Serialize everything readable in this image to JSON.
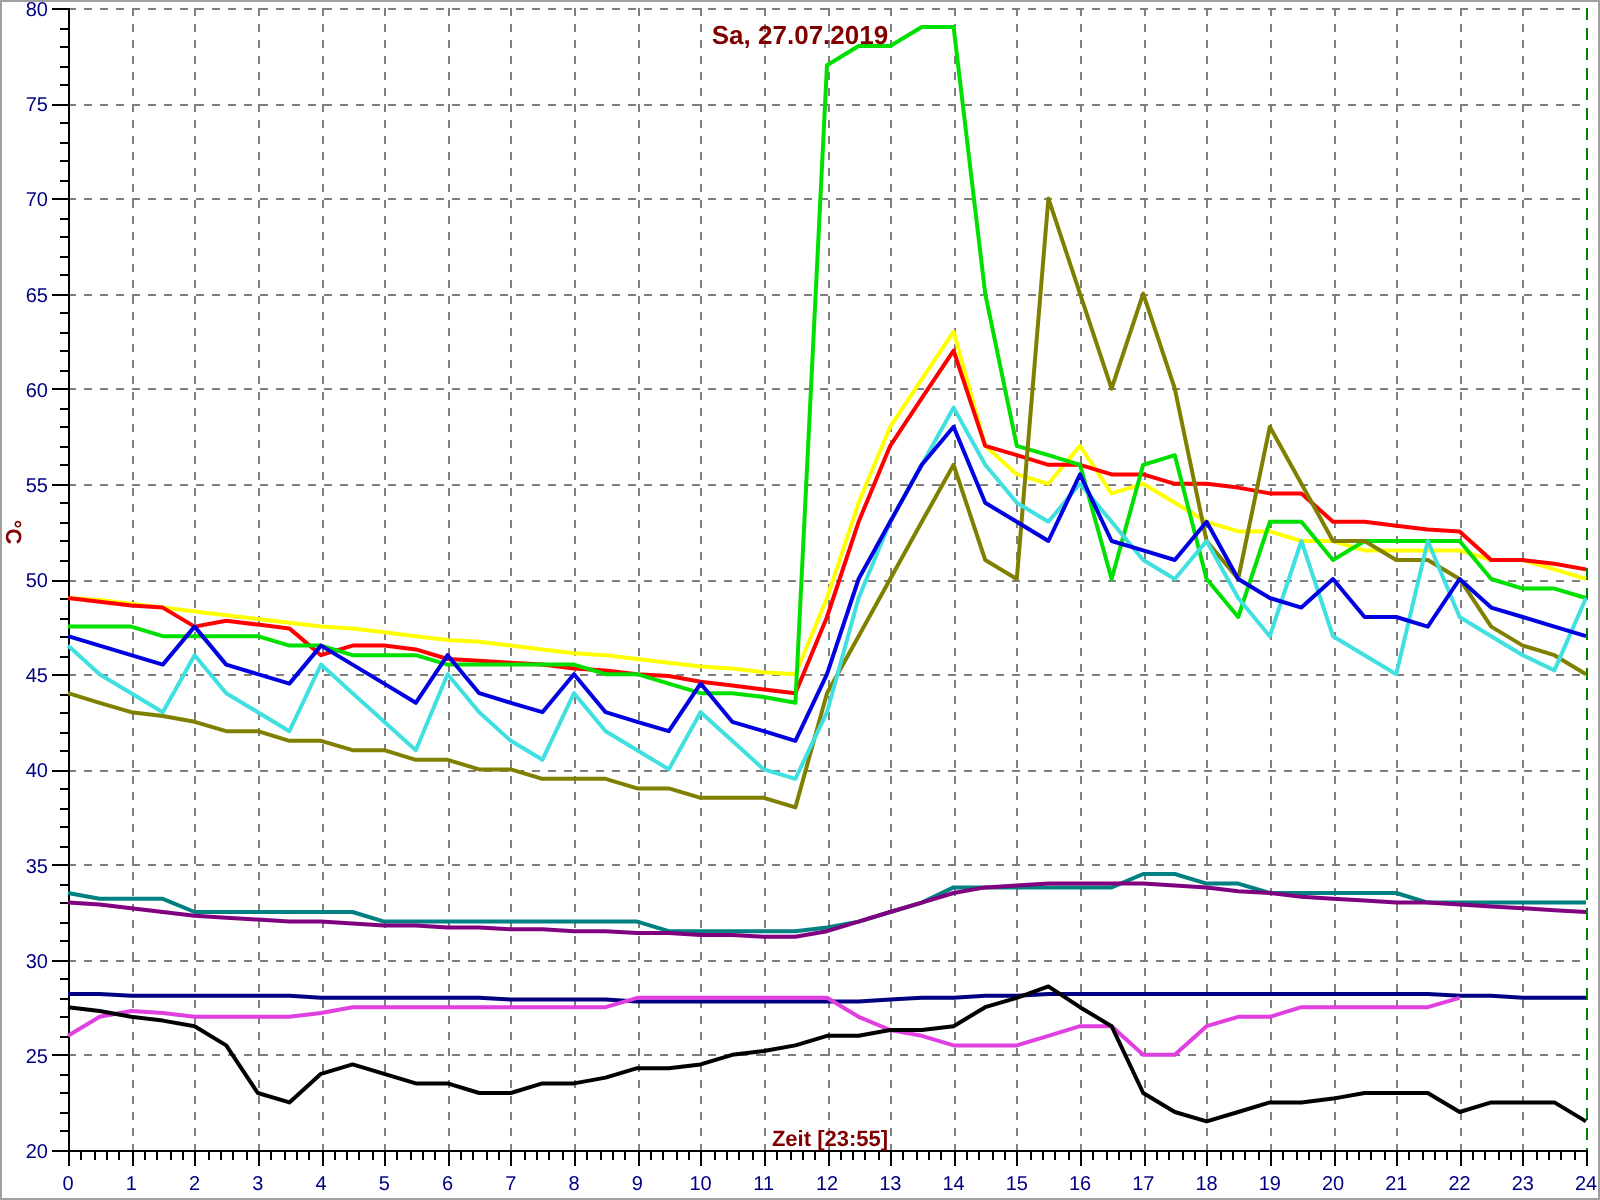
{
  "chart_data": {
    "type": "line",
    "grid": true,
    "title": "Sa, 27.07.2019",
    "xlabel": "Zeit [23:55]",
    "ylabel": "°C",
    "x": [
      0,
      0.5,
      1,
      1.5,
      2,
      2.5,
      3,
      3.5,
      4,
      4.5,
      5,
      5.5,
      6,
      6.5,
      7,
      7.5,
      8,
      8.5,
      9,
      9.5,
      10,
      10.5,
      11,
      11.5,
      12,
      12.5,
      13,
      13.5,
      14,
      14.5,
      15,
      15.5,
      16,
      16.5,
      17,
      17.5,
      18,
      18.5,
      19,
      19.5,
      20,
      20.5,
      21,
      21.5,
      22,
      22.5,
      23,
      23.5,
      24
    ],
    "xlim": [
      0,
      24
    ],
    "ylim": [
      20,
      80
    ],
    "xticks": [
      0,
      1,
      2,
      3,
      4,
      5,
      6,
      7,
      8,
      9,
      10,
      11,
      12,
      13,
      14,
      15,
      16,
      17,
      18,
      19,
      20,
      21,
      22,
      23,
      24
    ],
    "yticks": [
      20,
      25,
      30,
      35,
      40,
      45,
      50,
      55,
      60,
      65,
      70,
      75,
      80
    ],
    "series": [
      {
        "color": "#ffff00",
        "values": [
          49,
          48.9,
          48.7,
          48.5,
          48.3,
          48.1,
          47.9,
          47.7,
          47.5,
          47.4,
          47.2,
          47,
          46.8,
          46.7,
          46.5,
          46.3,
          46.1,
          46,
          45.8,
          45.6,
          45.4,
          45.3,
          45.1,
          45,
          49,
          54,
          58,
          60.5,
          63,
          57,
          55.5,
          55,
          57,
          54.5,
          55,
          54,
          53,
          52.5,
          52.5,
          52,
          52,
          51.5,
          51.5,
          51.5,
          51.5,
          51,
          51,
          50.5,
          50
        ]
      },
      {
        "color": "#ff0000",
        "values": [
          49,
          48.8,
          48.6,
          48.5,
          47.5,
          47.8,
          47.6,
          47.4,
          46,
          46.5,
          46.5,
          46.3,
          45.8,
          45.7,
          45.6,
          45.5,
          45.3,
          45.2,
          45,
          44.9,
          44.6,
          44.4,
          44.2,
          44,
          48,
          53,
          57,
          59.5,
          62,
          57,
          56.5,
          56,
          56,
          55.5,
          55.5,
          55,
          55,
          54.8,
          54.5,
          54.5,
          53,
          53,
          52.8,
          52.6,
          52.5,
          51,
          51,
          50.8,
          50.5
        ]
      },
      {
        "color": "#00e000",
        "values": [
          47.5,
          47.5,
          47.5,
          47,
          47,
          47,
          47,
          46.5,
          46.5,
          46,
          46,
          46,
          45.5,
          45.5,
          45.5,
          45.5,
          45.5,
          45,
          45,
          44.5,
          44,
          44,
          43.8,
          43.5,
          77,
          78,
          78,
          79,
          79,
          65,
          57,
          56.5,
          56,
          50,
          56,
          56.5,
          50,
          48,
          53,
          53,
          51,
          52,
          52,
          52,
          52,
          50,
          49.5,
          49.5,
          49
        ]
      },
      {
        "color": "#808000",
        "values": [
          44,
          43.5,
          43,
          42.8,
          42.5,
          42,
          42,
          41.5,
          41.5,
          41,
          41,
          40.5,
          40.5,
          40,
          40,
          39.5,
          39.5,
          39.5,
          39,
          39,
          38.5,
          38.5,
          38.5,
          38,
          44,
          47,
          50,
          53,
          56,
          51,
          50,
          70,
          65,
          60,
          65,
          60,
          52,
          50,
          58,
          55,
          52,
          52,
          51,
          51,
          50,
          47.5,
          46.5,
          46,
          45
        ]
      },
      {
        "color": "#40e0e0",
        "values": [
          46.5,
          45,
          44,
          43,
          46,
          44,
          43,
          42,
          45.5,
          44,
          42.5,
          41,
          45,
          43,
          41.5,
          40.5,
          44,
          42,
          41,
          40,
          43,
          41.5,
          40,
          39.5,
          43,
          49,
          53,
          56,
          59,
          56,
          54,
          53,
          55,
          53,
          51,
          50,
          52,
          49,
          47,
          52,
          47,
          46,
          45,
          52,
          48,
          47,
          46,
          45.2,
          49
        ]
      },
      {
        "color": "#0000e0",
        "values": [
          47,
          46.5,
          46,
          45.5,
          47.5,
          45.5,
          45,
          44.5,
          46.5,
          45.5,
          44.5,
          43.5,
          46,
          44,
          43.5,
          43,
          45,
          43,
          42.5,
          42,
          44.5,
          42.5,
          42,
          41.5,
          45,
          50,
          53,
          56,
          58,
          54,
          53,
          52,
          55.5,
          52,
          51.5,
          51,
          53,
          50,
          49,
          48.5,
          50,
          48,
          48,
          47.5,
          50,
          48.5,
          48,
          47.5,
          47
        ]
      },
      {
        "color": "#008080",
        "values": [
          33.5,
          33.2,
          33.2,
          33.2,
          32.5,
          32.5,
          32.5,
          32.5,
          32.5,
          32.5,
          32,
          32,
          32,
          32,
          32,
          32,
          32,
          32,
          32,
          31.5,
          31.5,
          31.5,
          31.5,
          31.5,
          31.7,
          32,
          32.5,
          33,
          33.8,
          33.8,
          33.8,
          33.8,
          33.8,
          33.8,
          34.5,
          34.5,
          34,
          34,
          33.5,
          33.5,
          33.5,
          33.5,
          33.5,
          33,
          33,
          33,
          33,
          33,
          33
        ]
      },
      {
        "color": "#800080",
        "values": [
          33,
          32.9,
          32.7,
          32.5,
          32.3,
          32.2,
          32.1,
          32,
          32,
          31.9,
          31.8,
          31.8,
          31.7,
          31.7,
          31.6,
          31.6,
          31.5,
          31.5,
          31.4,
          31.4,
          31.3,
          31.3,
          31.2,
          31.2,
          31.5,
          32,
          32.5,
          33,
          33.5,
          33.8,
          33.9,
          34,
          34,
          34,
          34,
          33.9,
          33.8,
          33.6,
          33.5,
          33.3,
          33.2,
          33.1,
          33,
          33,
          32.9,
          32.8,
          32.7,
          32.6,
          32.5
        ]
      },
      {
        "color": "#000080",
        "values": [
          28.2,
          28.2,
          28.1,
          28.1,
          28.1,
          28.1,
          28.1,
          28.1,
          28,
          28,
          28,
          28,
          28,
          28,
          27.9,
          27.9,
          27.9,
          27.9,
          27.8,
          27.8,
          27.8,
          27.8,
          27.8,
          27.8,
          27.8,
          27.8,
          27.9,
          28,
          28,
          28.1,
          28.1,
          28.2,
          28.2,
          28.2,
          28.2,
          28.2,
          28.2,
          28.2,
          28.2,
          28.2,
          28.2,
          28.2,
          28.2,
          28.2,
          28.1,
          28.1,
          28,
          28,
          28
        ]
      },
      {
        "color": "#e040e0",
        "values": [
          26,
          27,
          27.3,
          27.2,
          27,
          27,
          27,
          27,
          27.2,
          27.5,
          27.5,
          27.5,
          27.5,
          27.5,
          27.5,
          27.5,
          27.5,
          27.5,
          28,
          28,
          28,
          28,
          28,
          28,
          28,
          27,
          26.3,
          26,
          25.5,
          25.5,
          25.5,
          26,
          26.5,
          26.5,
          25,
          25,
          26.5,
          27,
          27,
          27.5,
          27.5,
          27.5,
          27.5,
          27.5,
          28,
          null,
          null,
          null,
          null
        ]
      },
      {
        "color": "#000000",
        "values": [
          27.5,
          27.3,
          27,
          26.8,
          26.5,
          25.5,
          23,
          22.5,
          24,
          24.5,
          24,
          23.5,
          23.5,
          23,
          23,
          23.5,
          23.5,
          23.8,
          24.3,
          24.3,
          24.5,
          25,
          25.2,
          25.5,
          26,
          26,
          26.3,
          26.3,
          26.5,
          27.5,
          28,
          28.6,
          27.5,
          26.5,
          23,
          22,
          21.5,
          22,
          22.5,
          22.5,
          22.7,
          23,
          23,
          23,
          22,
          22.5,
          22.5,
          22.5,
          21.5
        ]
      }
    ]
  }
}
